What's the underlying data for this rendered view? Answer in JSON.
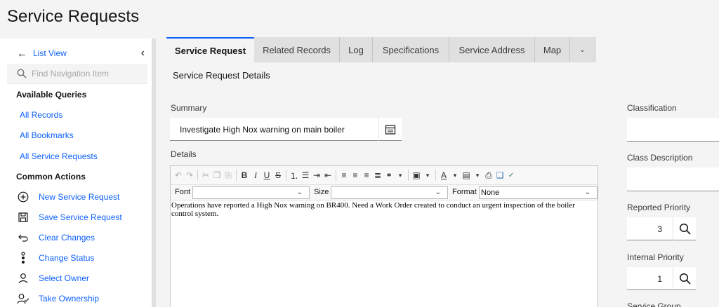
{
  "page": {
    "title": "Service Requests"
  },
  "sidebar": {
    "list_view": "List View",
    "search_placeholder": "Find Navigation Item",
    "queries_heading": "Available Queries",
    "queries": [
      "All Records",
      "All Bookmarks",
      "All Service Requests"
    ],
    "actions_heading": "Common Actions",
    "actions": [
      {
        "label": "New Service Request",
        "icon": "add-circle-icon"
      },
      {
        "label": "Save Service Request",
        "icon": "save-icon"
      },
      {
        "label": "Clear Changes",
        "icon": "undo-icon"
      },
      {
        "label": "Change Status",
        "icon": "status-icon"
      },
      {
        "label": "Select Owner",
        "icon": "user-icon"
      },
      {
        "label": "Take Ownership",
        "icon": "user-check-icon"
      }
    ]
  },
  "tabs": [
    "Service Request",
    "Related Records",
    "Log",
    "Specifications",
    "Service Address",
    "Map"
  ],
  "main": {
    "section_title": "Service Request Details",
    "summary_label": "Summary",
    "summary_value": "Investigate High Nox warning on main boiler",
    "details_label": "Details",
    "editor": {
      "font_label": "Font",
      "size_label": "Size",
      "format_label": "Format",
      "format_value": "None",
      "body_text": "Operations have reported a High Nox warning on BR400. Need a Work Order created to conduct an urgent inspection of the boiler control system."
    }
  },
  "right": {
    "classification_label": "Classification",
    "class_description_label": "Class Description",
    "reported_priority_label": "Reported Priority",
    "reported_priority_value": "3",
    "internal_priority_label": "Internal Priority",
    "internal_priority_value": "1",
    "service_group_label": "Service Group"
  },
  "colors": {
    "link": "#0f62fe",
    "active_tab_border": "#0f62fe",
    "background": "#f4f4f4"
  }
}
